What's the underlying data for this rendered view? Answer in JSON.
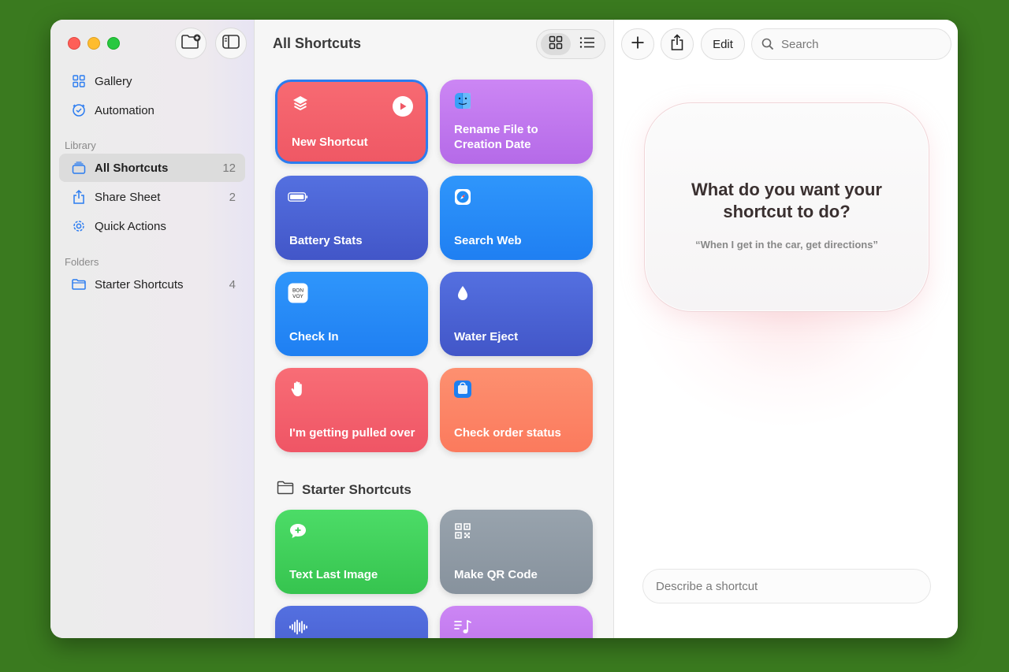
{
  "window": {
    "traffic_lights": [
      "close",
      "minimize",
      "zoom"
    ]
  },
  "sidebar": {
    "toolbar": {
      "new_folder_icon": "folder-plus-icon",
      "toggle_sidebar_icon": "sidebar-icon"
    },
    "top_items": [
      {
        "label": "Gallery",
        "icon": "grid-icon"
      },
      {
        "label": "Automation",
        "icon": "clock-check-icon"
      }
    ],
    "library_heading": "Library",
    "library_items": [
      {
        "label": "All Shortcuts",
        "count": "12",
        "icon": "stack-icon",
        "active": true
      },
      {
        "label": "Share Sheet",
        "count": "2",
        "icon": "share-icon"
      },
      {
        "label": "Quick Actions",
        "count": "",
        "icon": "gear-icon"
      }
    ],
    "folders_heading": "Folders",
    "folder_items": [
      {
        "label": "Starter Shortcuts",
        "count": "4",
        "icon": "folder-icon"
      }
    ]
  },
  "middle": {
    "title": "All Shortcuts",
    "view_modes": [
      "grid",
      "list"
    ],
    "tiles": [
      {
        "label": "New Shortcut",
        "color": "#f05f6a",
        "icon": "layers-icon"
      },
      {
        "label": "Rename File to Creation Date",
        "color": "#c277ee",
        "icon": "finder-icon"
      },
      {
        "label": "Battery Stats",
        "color": "#4a62d8",
        "icon": "battery-icon"
      },
      {
        "label": "Search Web",
        "color": "#2a8cf8",
        "icon": "safari-icon"
      },
      {
        "label": "Check In",
        "color": "#2a8cf8",
        "icon": "bonvoy-icon"
      },
      {
        "label": "Water Eject",
        "color": "#4a62d8",
        "icon": "drop-icon"
      },
      {
        "label": "I'm getting pulled over",
        "color": "#f45e6c",
        "icon": "hand-icon"
      },
      {
        "label": "Check order status",
        "color": "#fd8362",
        "icon": "store-app-icon"
      }
    ],
    "folder_section": "Starter Shortcuts",
    "starter_tiles": [
      {
        "label": "Text Last Image",
        "color": "#3ecf5a",
        "icon": "message-plus-icon"
      },
      {
        "label": "Make QR Code",
        "color": "#8c98a4",
        "icon": "qr-icon"
      },
      {
        "label": "",
        "color": "#4a62d8",
        "icon": "waveform-icon"
      },
      {
        "label": "",
        "color": "#c277ee",
        "icon": "music-list-icon"
      }
    ]
  },
  "right": {
    "toolbar": {
      "add_icon": "plus-icon",
      "share_icon": "share-icon",
      "edit_label": "Edit",
      "search_placeholder": "Search"
    },
    "prompt": {
      "title": "What do you want your shortcut to do?",
      "example": "“When I get in the car, get directions”"
    },
    "describe_placeholder": "Describe a shortcut"
  }
}
